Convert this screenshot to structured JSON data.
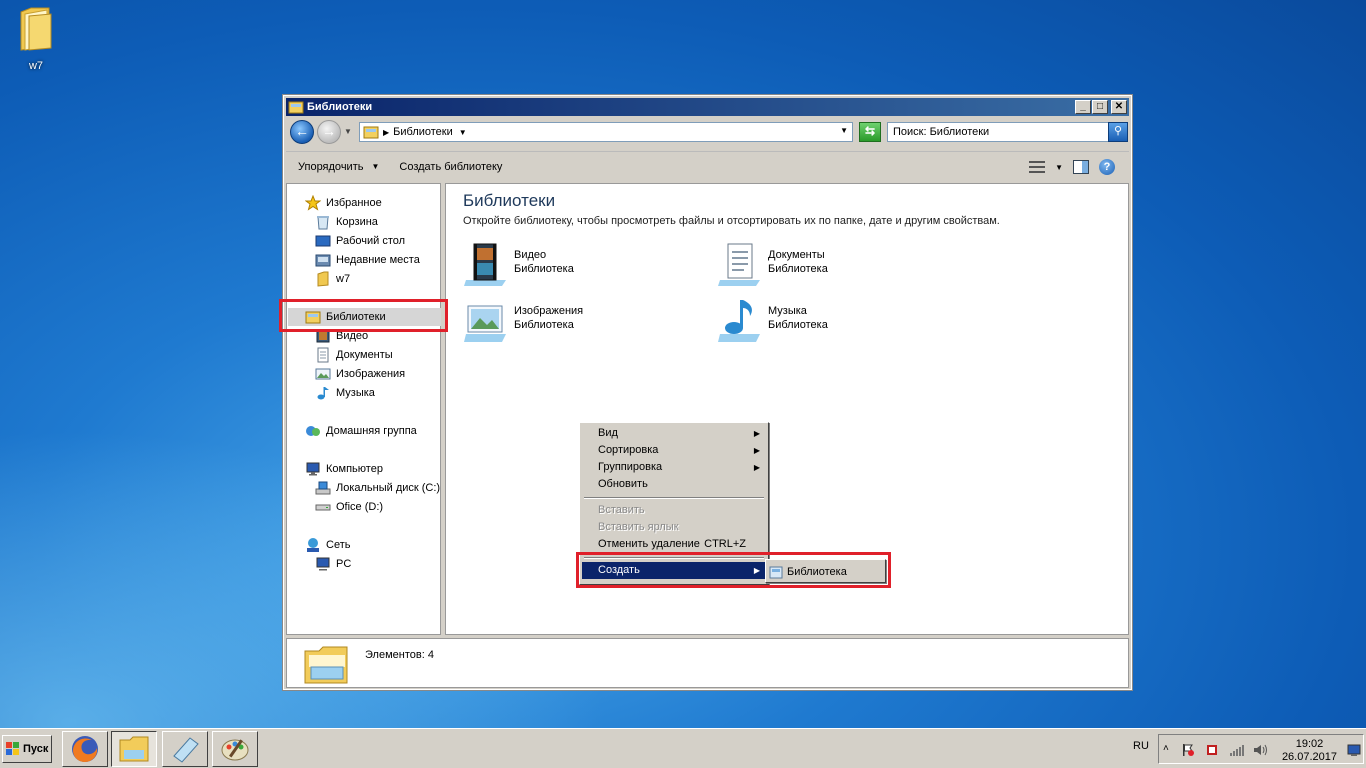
{
  "desktop": {
    "icons": [
      {
        "label": "w7"
      }
    ]
  },
  "window": {
    "title": "Библиотеки",
    "address": {
      "crumb": "Библиотеки"
    },
    "search": {
      "placeholder": "Поиск: Библиотеки"
    },
    "commands": {
      "organize": "Упорядочить",
      "new_library": "Создать библиотеку"
    },
    "nav": {
      "favorites": {
        "header": "Избранное",
        "items": [
          "Корзина",
          "Рабочий стол",
          "Недавние места",
          "w7"
        ]
      },
      "libraries": {
        "header": "Библиотеки",
        "items": [
          "Видео",
          "Документы",
          "Изображения",
          "Музыка"
        ]
      },
      "homegroup": "Домашняя группа",
      "computer": {
        "header": "Компьютер",
        "items": [
          "Локальный диск (C:)",
          "Ofice (D:)"
        ]
      },
      "network": {
        "header": "Сеть",
        "items": [
          "PC"
        ]
      }
    },
    "content": {
      "title": "Библиотеки",
      "subtitle": "Откройте библиотеку, чтобы просмотреть файлы и отсортировать их по папке, дате и другим свойствам.",
      "libraries": [
        {
          "name": "Видео",
          "type": "Библиотека",
          "icon": "video-library-icon"
        },
        {
          "name": "Документы",
          "type": "Библиотека",
          "icon": "documents-library-icon"
        },
        {
          "name": "Изображения",
          "type": "Библиотека",
          "icon": "pictures-library-icon"
        },
        {
          "name": "Музыка",
          "type": "Библиотека",
          "icon": "music-library-icon"
        }
      ]
    },
    "details": {
      "count": "Элементов: 4"
    }
  },
  "context_menu": {
    "items": {
      "view": "Вид",
      "sort": "Сортировка",
      "group": "Группировка",
      "refresh": "Обновить",
      "paste": "Вставить",
      "paste_shortcut": "Вставить ярлык",
      "undo_delete": "Отменить удаление",
      "undo_shortcut": "CTRL+Z",
      "create": "Создать"
    },
    "submenu": {
      "library": "Библиотека"
    }
  },
  "taskbar": {
    "start": "Пуск",
    "lang": "RU",
    "time": "19:02",
    "date": "26.07.2017"
  },
  "colors": {
    "highlight": "#e0202a",
    "menu_active": "#0a246a",
    "title_gradient_start": "#0a246a",
    "title_gradient_end": "#3a6ea5"
  }
}
